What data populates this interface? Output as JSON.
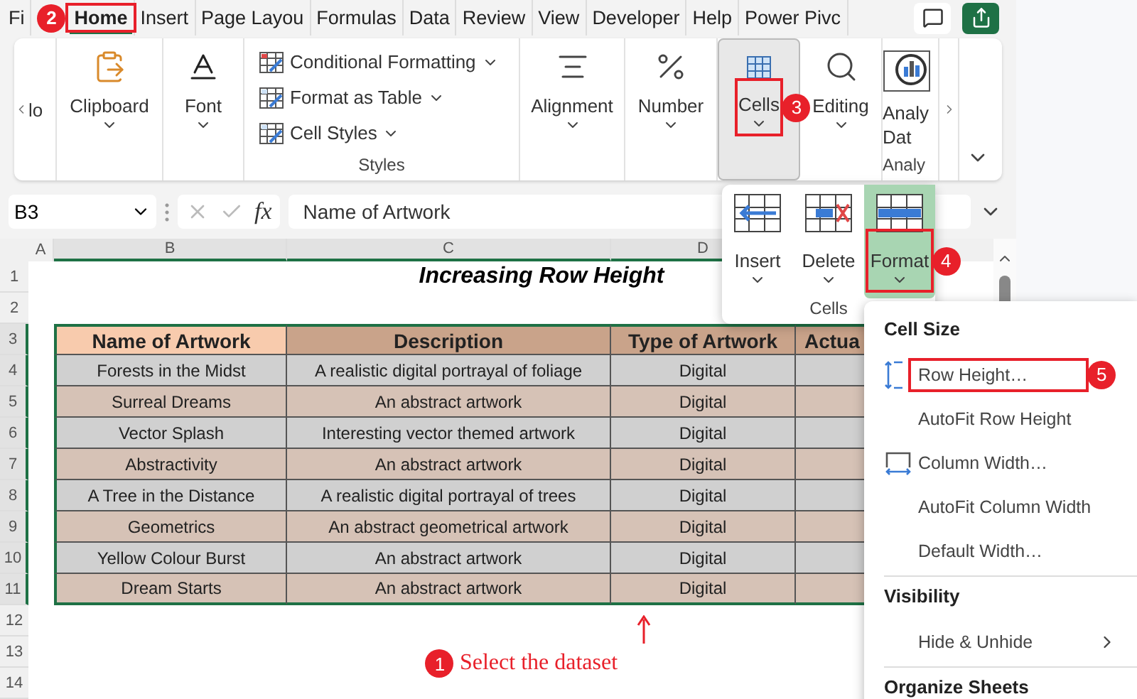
{
  "tabs": [
    {
      "label": "Fi",
      "selected": false
    },
    {
      "label": "Home",
      "selected": true,
      "callout": "2"
    },
    {
      "label": "Insert",
      "selected": false
    },
    {
      "label": "Page Layou",
      "selected": false
    },
    {
      "label": "Formulas",
      "selected": false
    },
    {
      "label": "Data",
      "selected": false
    },
    {
      "label": "Review",
      "selected": false
    },
    {
      "label": "View",
      "selected": false
    },
    {
      "label": "Developer",
      "selected": false
    },
    {
      "label": "Help",
      "selected": false
    },
    {
      "label": "Power Pivc",
      "selected": false
    }
  ],
  "ribbon": {
    "groups": [
      {
        "kind": "cut",
        "label": "lo"
      },
      {
        "kind": "large",
        "label": "Clipboard",
        "selected": false
      },
      {
        "kind": "large",
        "label": "Font",
        "selected": false
      },
      {
        "kind": "list",
        "label": "Styles",
        "items": [
          "Conditional Formatting",
          "Format as Table",
          "Cell Styles"
        ]
      },
      {
        "kind": "large",
        "label": "Alignment",
        "selected": false
      },
      {
        "kind": "large",
        "label": "Number",
        "selected": false
      },
      {
        "kind": "large",
        "label": "Cells",
        "selected": true,
        "callout": "3"
      },
      {
        "kind": "large",
        "label": "Editing",
        "selected": false
      },
      {
        "kind": "analyze",
        "lines": [
          "Analy",
          "Dat"
        ],
        "label": "Analy"
      }
    ]
  },
  "formula_bar": {
    "name_box": "B3",
    "fx": "fx",
    "formula": "Name of Artwork"
  },
  "sheet": {
    "columns": [
      "A",
      "B",
      "C",
      "D"
    ],
    "rows": [
      "1",
      "2",
      "3",
      "4",
      "5",
      "6",
      "7",
      "8",
      "9",
      "10",
      "11",
      "12",
      "13",
      "14"
    ],
    "title": "Increasing Row Height",
    "table": {
      "columns": [
        "Name of Artwork",
        "Description",
        "Type of Artwork",
        "Actua"
      ],
      "rows": [
        [
          "Forests in the Midst",
          "A realistic digital portrayal of  foliage",
          "Digital"
        ],
        [
          "Surreal Dreams",
          "An abstract artwork",
          "Digital"
        ],
        [
          "Vector Splash",
          "Interesting vector themed artwork",
          "Digital"
        ],
        [
          "Abstractivity",
          "An abstract artwork",
          "Digital"
        ],
        [
          "A Tree in the Distance",
          "A realistic digital portrayal of trees",
          "Digital"
        ],
        [
          "Geometrics",
          "An abstract geometrical artwork",
          "Digital"
        ],
        [
          "Yellow Colour Burst",
          "An abstract artwork",
          "Digital"
        ],
        [
          "Dream Starts",
          "An abstract artwork",
          "Digital"
        ]
      ]
    }
  },
  "annotation": {
    "callout": "1",
    "text": "Select the dataset"
  },
  "cells_panel": {
    "buttons": [
      {
        "label": "Insert",
        "selected": false
      },
      {
        "label": "Delete",
        "selected": false
      },
      {
        "label": "Format",
        "selected": true,
        "callout": "4"
      }
    ],
    "label": "Cells"
  },
  "format_menu": {
    "sections": [
      {
        "heading": "Cell Size",
        "items": [
          {
            "label": "Row Height…",
            "callout": "5"
          },
          {
            "label": "AutoFit Row Height"
          },
          {
            "label": "Column Width…"
          },
          {
            "label": "AutoFit Column Width"
          },
          {
            "label": "Default Width…"
          }
        ]
      },
      {
        "heading": "Visibility",
        "items": [
          {
            "label": "Hide & Unhide",
            "submenu": true
          }
        ]
      },
      {
        "heading": "Organize Sheets"
      }
    ]
  }
}
